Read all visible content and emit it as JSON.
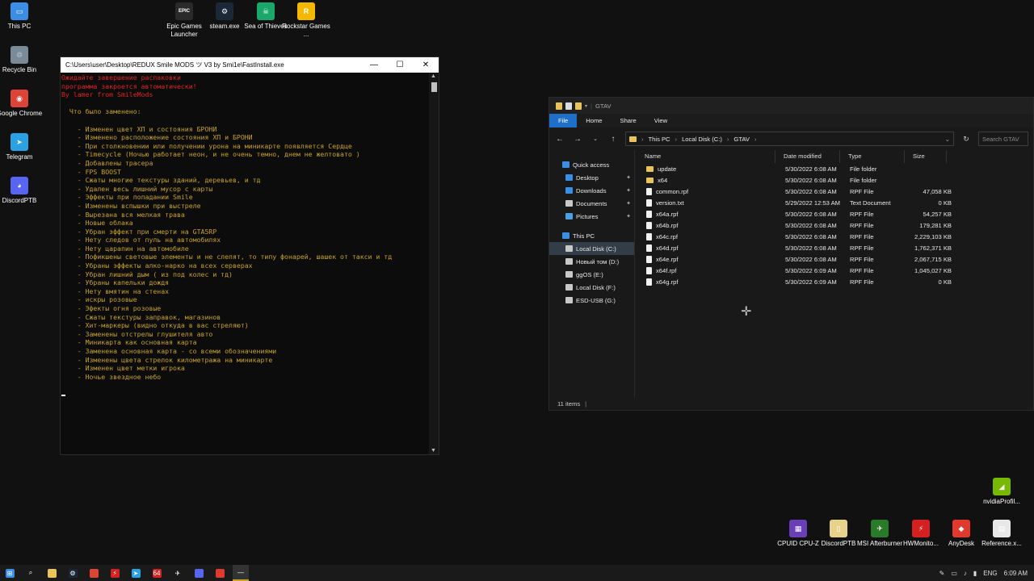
{
  "desktop_icons": [
    {
      "label": "This PC",
      "color": "#3a8ee6",
      "glyph": "▭"
    },
    {
      "label": "Recycle Bin",
      "color": "#7a8a99",
      "glyph": "♲"
    },
    {
      "label": "Google Chrome",
      "color": "#db4437",
      "glyph": "◉"
    },
    {
      "label": "Telegram",
      "color": "#2aa1e0",
      "glyph": "➤"
    },
    {
      "label": "DiscordPTB",
      "color": "#5865f2",
      "glyph": "◕"
    },
    {
      "label": "Epic Games Launcher",
      "color": "#2a2a2a",
      "glyph": "EPIC"
    },
    {
      "label": "steam.exe",
      "color": "#1b2838",
      "glyph": "⚙"
    },
    {
      "label": "Sea of Thieves",
      "color": "#1aa86a",
      "glyph": "☠"
    },
    {
      "label": "Rockstar Games ...",
      "color": "#f5b800",
      "glyph": "R"
    }
  ],
  "bottom_icons": [
    {
      "label": "nvidiaProfil...",
      "color": "#76b900",
      "glyph": "◢"
    },
    {
      "label": "CPUID CPU-Z",
      "color": "#6a3fb5",
      "glyph": "▦"
    },
    {
      "label": "DiscordPTB",
      "color": "#e6d28a",
      "glyph": "▯"
    },
    {
      "label": "MSI Afterburner",
      "color": "#2a7a2a",
      "glyph": "✈"
    },
    {
      "label": "HWMonito...",
      "color": "#d42020",
      "glyph": "⚡"
    },
    {
      "label": "AnyDesk",
      "color": "#e03a2e",
      "glyph": "◆"
    },
    {
      "label": "Reference.x...",
      "color": "#e8e8e8",
      "glyph": "▤"
    }
  ],
  "console": {
    "title": "C:\\Users\\user\\Desktop\\REDUX Smile MODS ツ V3 by Smi1e\\FastInstall.exe",
    "red_lines": [
      "Ожидайте завершение распаковки",
      "программа закроется автоматически!",
      "By lamer from SmileMods"
    ],
    "header": "  Что было заменено:",
    "lines": [
      "    - Изменен цвет ХП и состояния БРОНИ",
      "    - Изменено расположение состояния ХП и БРОНИ",
      "    - При столкновении или получении урона на миникарте появляется Сердце",
      "    - Timecycle (Ночью работает неон, и не очень темно, днем не желтовато )",
      "    - Добавлены трасера",
      "    - FPS BOOST",
      "    - Сжаты многие текстуры зданий, деревьев, и тд",
      "    - Удален весь лишний мусор с карты",
      "    - Эффекты при попадании Smile",
      "    - Изменены вспышки при выстреле",
      "    - Вырезана вся мелкая трава",
      "    - Новые облака",
      "    - Убран эффект при смерти на GTA5RP",
      "    - Нету следов от пуль на автомобилях",
      "    - Нету царапин на автомобиле",
      "    - Пофикшены световые элементы и не слепят, то типу фонарей, шашек от такси и тд",
      "    - Убраны эффекты алко-нарко на всех серверах",
      "    - Убран лишний дым ( из под колес и тд)",
      "    - Убраны капельки дождя",
      "    - Нету вмятин на стенах",
      "    - искры розовые",
      "    - Эфекты огня розовые",
      "    - Сжаты текстуры заправок, магазинов",
      "    - Хит-маркеры (видно откуда в вас стреляют)",
      "    - Заменены отстрелы глушителя авто",
      "    - Миникарта как основная карта",
      "    - Заменена основная карта - со всеми обозначениями",
      "    - Изменены цвета стрелок километража на миникарте",
      "    - Изменен цвет метки игрока",
      "    - Ночье звездное небо"
    ]
  },
  "explorer": {
    "title": "GTAV",
    "tabs": [
      "File",
      "Home",
      "Share",
      "View"
    ],
    "path": [
      "This PC",
      "Local Disk (C:)",
      "GTAV"
    ],
    "search_placeholder": "Search GTAV",
    "columns": [
      "Name",
      "Date modified",
      "Type",
      "Size"
    ],
    "sidebar": [
      {
        "label": "Quick access",
        "top": true,
        "color": "#3a8ee6",
        "pin": false
      },
      {
        "label": "Desktop",
        "color": "#3a8ee6",
        "pin": true
      },
      {
        "label": "Downloads",
        "color": "#3a8ee6",
        "pin": true
      },
      {
        "label": "Documents",
        "color": "#c8c8c8",
        "pin": true
      },
      {
        "label": "Pictures",
        "color": "#4aa0e0",
        "pin": true
      },
      {
        "label": "This PC",
        "top": true,
        "color": "#3a8ee6",
        "pin": false
      },
      {
        "label": "Local Disk (C:)",
        "color": "#c8c8c8",
        "pin": false,
        "selected": true
      },
      {
        "label": "Новый том (D:)",
        "color": "#c8c8c8",
        "pin": false
      },
      {
        "label": "ggOS (E:)",
        "color": "#c8c8c8",
        "pin": false
      },
      {
        "label": "Local Disk (F:)",
        "color": "#c8c8c8",
        "pin": false
      },
      {
        "label": "ESD-USB (G:)",
        "color": "#c8c8c8",
        "pin": false
      }
    ],
    "files": [
      {
        "name": "update",
        "date": "5/30/2022 6:08 AM",
        "type": "File folder",
        "size": "",
        "folder": true
      },
      {
        "name": "x64",
        "date": "5/30/2022 6:08 AM",
        "type": "File folder",
        "size": "",
        "folder": true
      },
      {
        "name": "common.rpf",
        "date": "5/30/2022 6:08 AM",
        "type": "RPF File",
        "size": "47,058 KB",
        "folder": false
      },
      {
        "name": "version.txt",
        "date": "5/29/2022 12:53 AM",
        "type": "Text Document",
        "size": "0 KB",
        "folder": false
      },
      {
        "name": "x64a.rpf",
        "date": "5/30/2022 6:08 AM",
        "type": "RPF File",
        "size": "54,257 KB",
        "folder": false
      },
      {
        "name": "x64b.rpf",
        "date": "5/30/2022 6:08 AM",
        "type": "RPF File",
        "size": "179,281 KB",
        "folder": false
      },
      {
        "name": "x64c.rpf",
        "date": "5/30/2022 6:08 AM",
        "type": "RPF File",
        "size": "2,229,103 KB",
        "folder": false
      },
      {
        "name": "x64d.rpf",
        "date": "5/30/2022 6:08 AM",
        "type": "RPF File",
        "size": "1,762,371 KB",
        "folder": false
      },
      {
        "name": "x64e.rpf",
        "date": "5/30/2022 6:08 AM",
        "type": "RPF File",
        "size": "2,067,715 KB",
        "folder": false
      },
      {
        "name": "x64f.rpf",
        "date": "5/30/2022 6:09 AM",
        "type": "RPF File",
        "size": "1,045,027 KB",
        "folder": false
      },
      {
        "name": "x64g.rpf",
        "date": "5/30/2022 6:09 AM",
        "type": "RPF File",
        "size": "0 KB",
        "folder": false
      }
    ],
    "status": "11 items"
  },
  "taskbar": {
    "apps": [
      {
        "name": "start",
        "color": "#3a8ee6",
        "glyph": "⊞"
      },
      {
        "name": "search",
        "color": "",
        "glyph": "⌕"
      },
      {
        "name": "explorer",
        "color": "#e8c45a",
        "glyph": ""
      },
      {
        "name": "steam",
        "color": "#1b2838",
        "glyph": "⚙"
      },
      {
        "name": "chrome",
        "color": "#db4437",
        "glyph": ""
      },
      {
        "name": "hwmonitor",
        "color": "#d42020",
        "glyph": "⚡"
      },
      {
        "name": "telegram",
        "color": "#2aa1e0",
        "glyph": "➤"
      },
      {
        "name": "cpu-z",
        "color": "#d42020",
        "glyph": "64"
      },
      {
        "name": "afterburner",
        "color": "",
        "glyph": "✈"
      },
      {
        "name": "discord",
        "color": "#5865f2",
        "glyph": ""
      },
      {
        "name": "anydesk",
        "color": "#e03a2e",
        "glyph": ""
      },
      {
        "name": "console",
        "color": "",
        "glyph": "—",
        "active": true
      }
    ],
    "lang": "ENG",
    "time": "6:09 AM"
  }
}
